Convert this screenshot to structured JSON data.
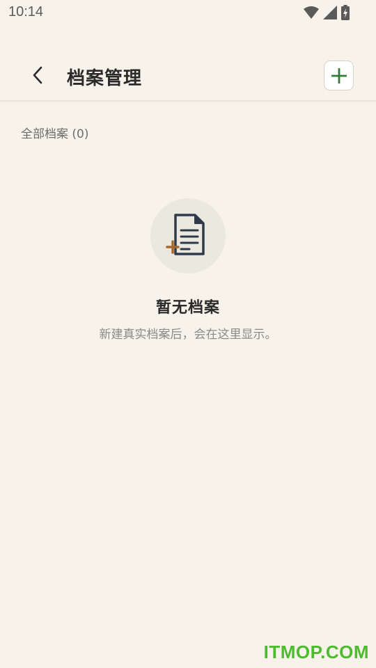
{
  "status_bar": {
    "time": "10:14",
    "icons": [
      "wifi-icon",
      "signal-icon",
      "battery-charging-icon"
    ]
  },
  "header": {
    "title": "档案管理",
    "back_icon": "chevron-left-icon",
    "add_icon": "plus-icon"
  },
  "section": {
    "label": "全部档案 (0)"
  },
  "empty_state": {
    "icon": "document-add-icon",
    "title": "暂无档案",
    "description": "新建真实档案后，会在这里显示。"
  },
  "watermark": {
    "text": "ITMOP.COM"
  },
  "colors": {
    "background": "#f7f3ea",
    "accent_green": "#2e7d32",
    "icon_dark": "#2f3a48",
    "icon_plus_brown": "#a8682a",
    "watermark_green": "#4dbb2e"
  }
}
